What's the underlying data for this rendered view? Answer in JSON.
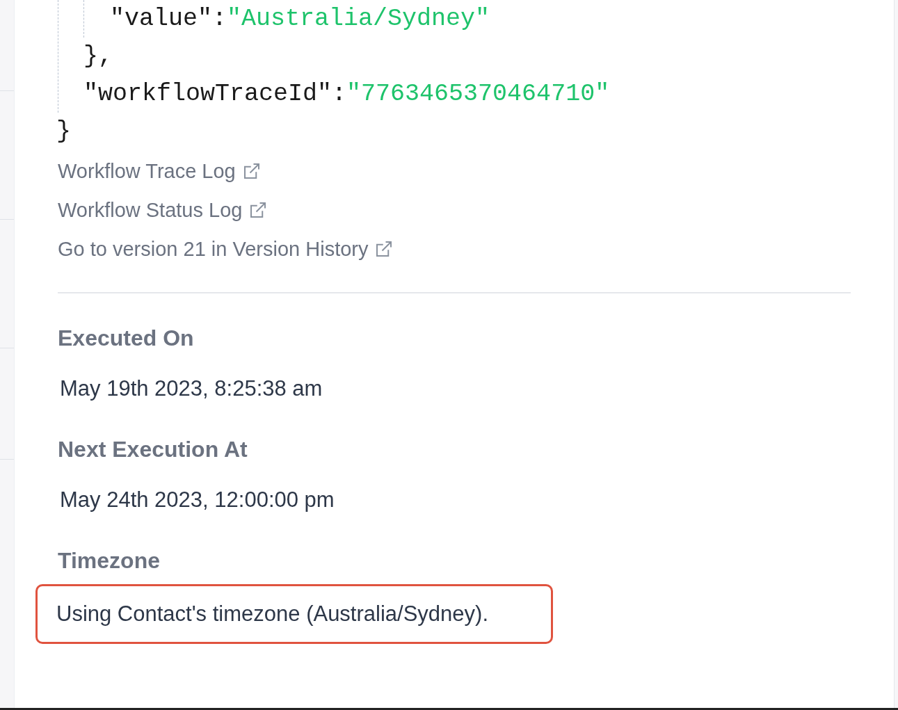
{
  "json_viewer": {
    "nested_object": {
      "pairs": [
        {
          "key": "\"value\"",
          "colon": ":",
          "value": "\"Australia/Sydney\""
        }
      ],
      "closing": "},"
    },
    "pairs": [
      {
        "key": "\"workflowTraceId\"",
        "colon": ":",
        "value": "\"7763465370464710\""
      }
    ],
    "closing": "}"
  },
  "links": [
    {
      "label": "Workflow Trace Log"
    },
    {
      "label": "Workflow Status Log"
    },
    {
      "label": "Go to version 21 in Version History"
    }
  ],
  "fields": [
    {
      "label": "Executed On",
      "value": "May 19th 2023, 8:25:38 am",
      "highlighted": false
    },
    {
      "label": "Next Execution At",
      "value": "May 24th 2023, 12:00:00 pm",
      "highlighted": false
    },
    {
      "label": "Timezone",
      "value": "Using Contact's timezone (Australia/Sydney).",
      "highlighted": true
    }
  ]
}
